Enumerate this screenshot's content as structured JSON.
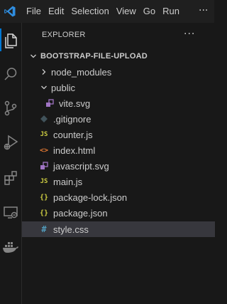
{
  "menu": {
    "items": [
      "File",
      "Edit",
      "Selection",
      "View",
      "Go",
      "Run"
    ],
    "more": "···"
  },
  "activity_bar": {
    "items": [
      "explorer-icon",
      "search-icon",
      "source-control-icon",
      "run-debug-icon",
      "extensions-icon",
      "remote-explorer-icon",
      "docker-icon"
    ],
    "active": "explorer-icon",
    "accent": "#0078d4"
  },
  "explorer": {
    "title": "EXPLORER",
    "more": "···",
    "folder": "BOOTSTRAP-FILE-UPLOAD",
    "entries": [
      {
        "name": "node_modules",
        "type": "folder",
        "expanded": false
      },
      {
        "name": "public",
        "type": "folder",
        "expanded": true
      },
      {
        "name": "vite.svg",
        "type": "svg"
      },
      {
        "name": ".gitignore",
        "type": "git"
      },
      {
        "name": "counter.js",
        "type": "js",
        "badge": "JS"
      },
      {
        "name": "index.html",
        "type": "html",
        "badge": "<>"
      },
      {
        "name": "javascript.svg",
        "type": "svg"
      },
      {
        "name": "main.js",
        "type": "js",
        "badge": "JS"
      },
      {
        "name": "package-lock.json",
        "type": "json",
        "badge": "{}"
      },
      {
        "name": "package.json",
        "type": "json",
        "badge": "{}"
      },
      {
        "name": "style.css",
        "type": "css",
        "badge": "#",
        "selected": true
      }
    ]
  },
  "colors": {
    "background": "#181818",
    "selected_row": "#37373d",
    "vscode_blue": "#2f8ee0",
    "js_yellow": "#cbcb41",
    "html_orange": "#e37933",
    "css_blue": "#519aba",
    "svg_purple": "#a074c4"
  }
}
